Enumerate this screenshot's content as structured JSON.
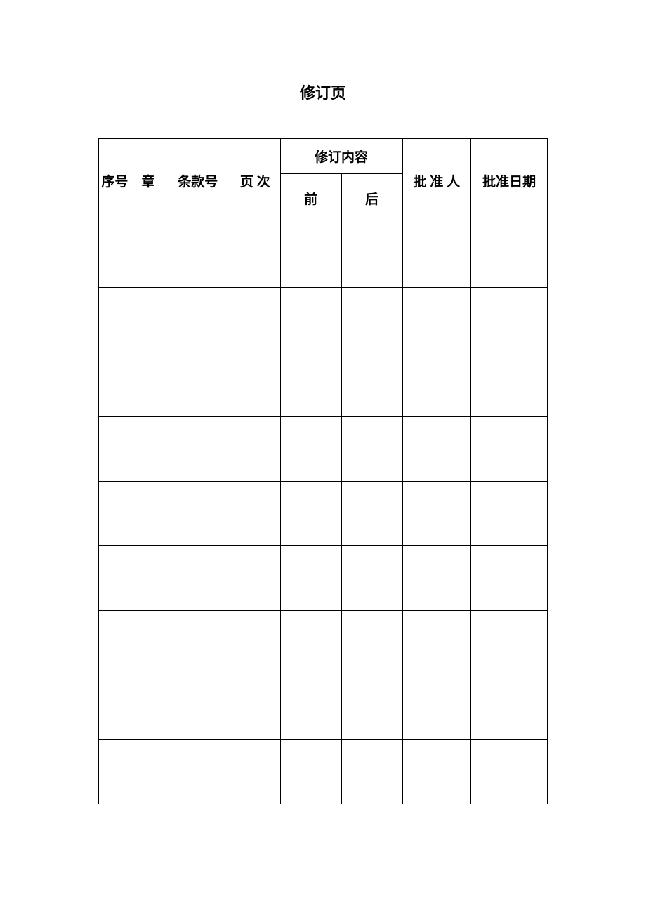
{
  "title": "修订页",
  "headers": {
    "seq": "序号",
    "chapter": "章",
    "clause": "条款号",
    "page": "页 次",
    "revision_content": "修订内容",
    "before": "前",
    "after": "后",
    "approver": "批 准 人",
    "approval_date": "批准日期"
  },
  "rows": [
    {
      "seq": "",
      "chapter": "",
      "clause": "",
      "page": "",
      "before": "",
      "after": "",
      "approver": "",
      "date": ""
    },
    {
      "seq": "",
      "chapter": "",
      "clause": "",
      "page": "",
      "before": "",
      "after": "",
      "approver": "",
      "date": ""
    },
    {
      "seq": "",
      "chapter": "",
      "clause": "",
      "page": "",
      "before": "",
      "after": "",
      "approver": "",
      "date": ""
    },
    {
      "seq": "",
      "chapter": "",
      "clause": "",
      "page": "",
      "before": "",
      "after": "",
      "approver": "",
      "date": ""
    },
    {
      "seq": "",
      "chapter": "",
      "clause": "",
      "page": "",
      "before": "",
      "after": "",
      "approver": "",
      "date": ""
    },
    {
      "seq": "",
      "chapter": "",
      "clause": "",
      "page": "",
      "before": "",
      "after": "",
      "approver": "",
      "date": ""
    },
    {
      "seq": "",
      "chapter": "",
      "clause": "",
      "page": "",
      "before": "",
      "after": "",
      "approver": "",
      "date": ""
    },
    {
      "seq": "",
      "chapter": "",
      "clause": "",
      "page": "",
      "before": "",
      "after": "",
      "approver": "",
      "date": ""
    },
    {
      "seq": "",
      "chapter": "",
      "clause": "",
      "page": "",
      "before": "",
      "after": "",
      "approver": "",
      "date": ""
    }
  ]
}
